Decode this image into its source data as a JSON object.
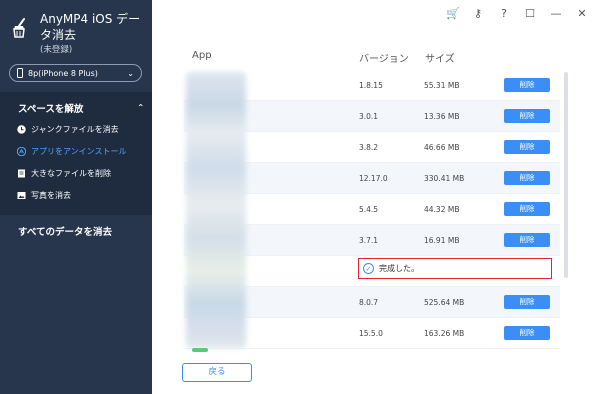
{
  "app": {
    "title": "AnyMP4 iOS データ消去",
    "subtitle": "(未登録)"
  },
  "device": {
    "label": "8p(iPhone 8 Plus)"
  },
  "sidebar": {
    "section_title": "スペースを解放",
    "items": [
      {
        "label": "ジャンクファイルを消去",
        "icon": "clock-icon",
        "active": false
      },
      {
        "label": "アプリをアンインストール",
        "icon": "app-store-icon",
        "active": true
      },
      {
        "label": "大きなファイルを削除",
        "icon": "file-icon",
        "active": false
      },
      {
        "label": "写真を消去",
        "icon": "photo-icon",
        "active": false
      }
    ],
    "erase_all": "すべてのデータを消去"
  },
  "table": {
    "headers": {
      "app": "App",
      "version": "バージョン",
      "size": "サイズ"
    },
    "rows": [
      {
        "version": "1.8.15",
        "size": "55.31 MB",
        "action": "削除"
      },
      {
        "version": "3.0.1",
        "size": "13.36 MB",
        "action": "削除"
      },
      {
        "version": "3.8.2",
        "size": "46.66 MB",
        "action": "削除"
      },
      {
        "version": "12.17.0",
        "size": "330.41 MB",
        "action": "削除"
      },
      {
        "version": "5.4.5",
        "size": "44.32 MB",
        "action": "削除"
      },
      {
        "version": "3.7.1",
        "size": "16.91 MB",
        "action": "削除"
      },
      {
        "done": "完成した。"
      },
      {
        "version": "8.0.7",
        "size": "525.64 MB",
        "action": "削除"
      },
      {
        "version": "15.5.0",
        "size": "163.26 MB",
        "action": "削除"
      }
    ]
  },
  "back_button": "戻る",
  "colors": {
    "sidebar": "#27364d",
    "accent": "#3a8ef6",
    "highlight_border": "#e0262d"
  }
}
